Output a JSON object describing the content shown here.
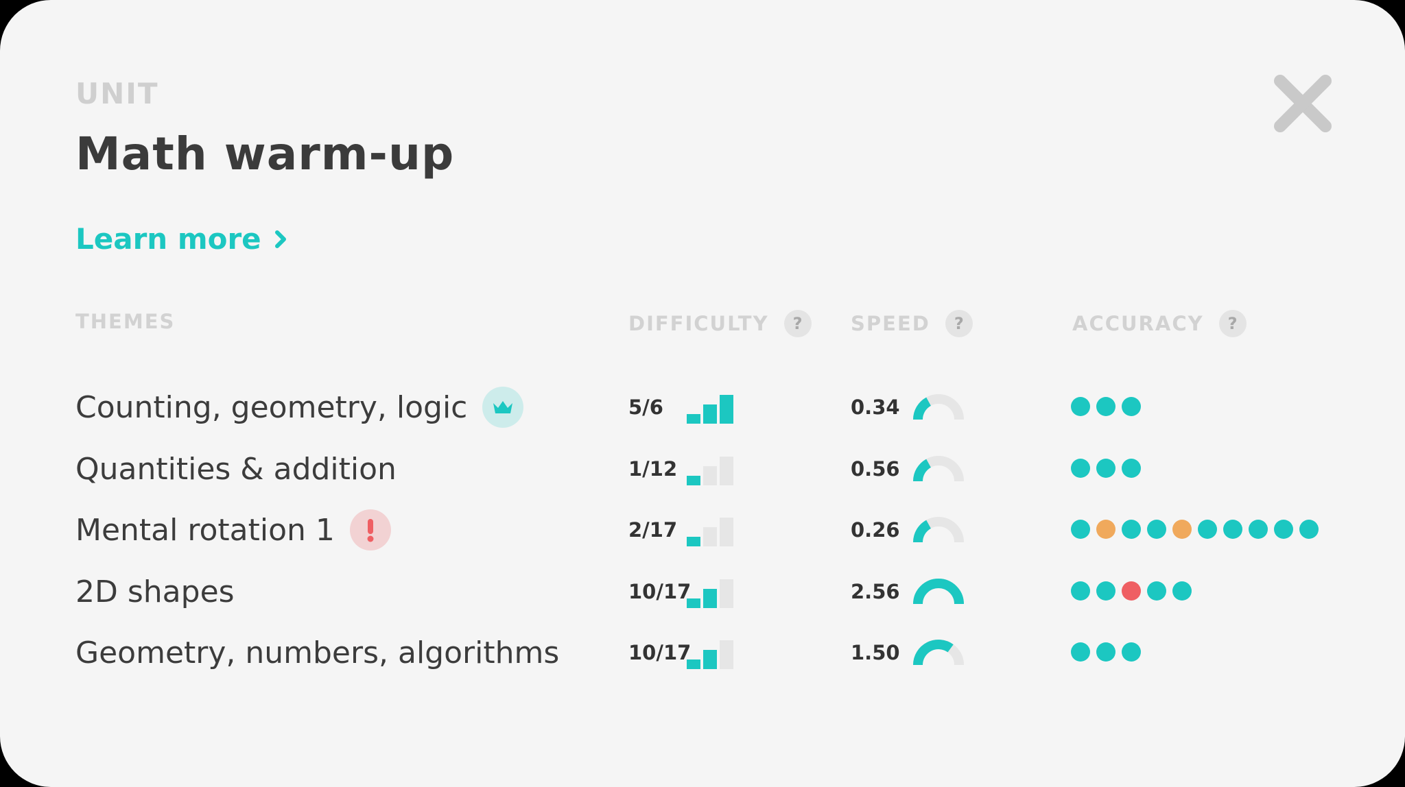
{
  "header": {
    "unit_label": "UNIT",
    "title": "Math warm-up",
    "learn_more": "Learn more"
  },
  "colors": {
    "accent": "#1cc7c1",
    "correct": "#1cc7c1",
    "partial": "#f0a95c",
    "wrong": "#ef5f63",
    "inactive": "#e6e6e6"
  },
  "columns": {
    "themes": "THEMES",
    "difficulty": "DIFFICULTY",
    "speed": "SPEED",
    "accuracy": "ACCURACY",
    "help": "?"
  },
  "rows": [
    {
      "theme": "Counting, geometry, logic",
      "badge": "crown-icon",
      "difficulty": "5/6",
      "difficulty_level": 3,
      "speed": "0.34",
      "speed_fraction": 0.34,
      "accuracy": [
        "correct",
        "correct",
        "correct"
      ]
    },
    {
      "theme": "Quantities & addition",
      "badge": "",
      "difficulty": "1/12",
      "difficulty_level": 1,
      "speed": "0.56",
      "speed_fraction": 0.34,
      "accuracy": [
        "correct",
        "correct",
        "correct"
      ]
    },
    {
      "theme": "Mental rotation 1",
      "badge": "exclamation-icon",
      "difficulty": "2/17",
      "difficulty_level": 1,
      "speed": "0.26",
      "speed_fraction": 0.34,
      "accuracy": [
        "correct",
        "partial",
        "correct",
        "correct",
        "partial",
        "correct",
        "correct",
        "correct",
        "correct",
        "correct"
      ]
    },
    {
      "theme": "2D shapes",
      "badge": "",
      "difficulty": "10/17",
      "difficulty_level": 2,
      "speed": "2.56",
      "speed_fraction": 1.0,
      "accuracy": [
        "correct",
        "correct",
        "wrong",
        "correct",
        "correct"
      ]
    },
    {
      "theme": "Geometry, numbers, algorithms",
      "badge": "",
      "difficulty": "10/17",
      "difficulty_level": 2,
      "speed": "1.50",
      "speed_fraction": 0.7,
      "accuracy": [
        "correct",
        "correct",
        "correct"
      ]
    }
  ]
}
